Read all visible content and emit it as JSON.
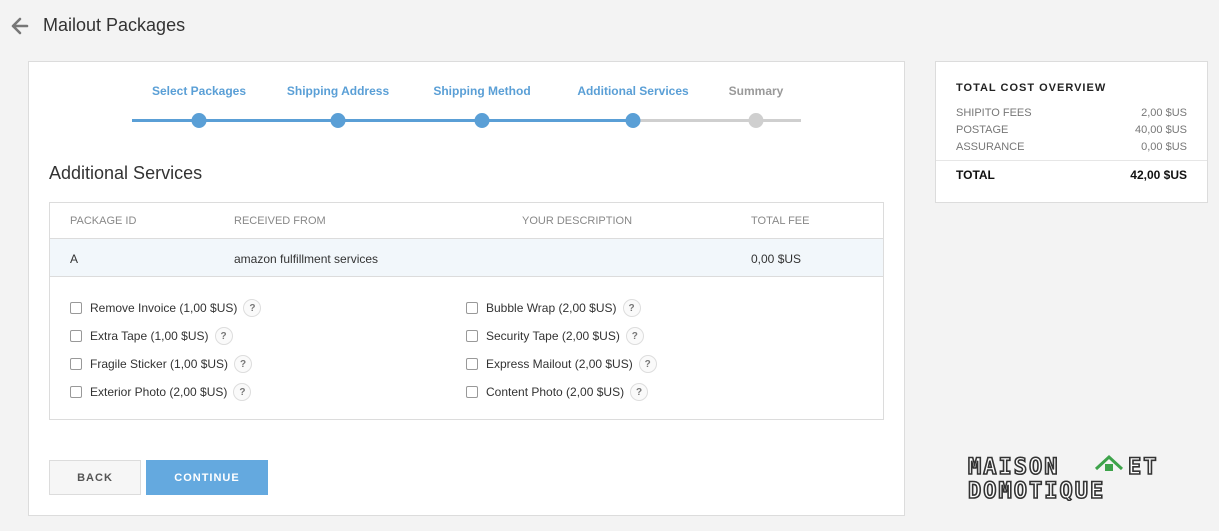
{
  "header": {
    "title": "Mailout Packages"
  },
  "stepper": {
    "steps": [
      {
        "label": "Select Packages",
        "state": "done"
      },
      {
        "label": "Shipping Address",
        "state": "done"
      },
      {
        "label": "Shipping Method",
        "state": "done"
      },
      {
        "label": "Additional Services",
        "state": "current"
      },
      {
        "label": "Summary",
        "state": "todo"
      }
    ]
  },
  "section": {
    "title": "Additional Services"
  },
  "table": {
    "columns": [
      "PACKAGE ID",
      "RECEIVED FROM",
      "YOUR DESCRIPTION",
      "TOTAL FEE"
    ],
    "rows": [
      {
        "package_id": "A",
        "received_from": "amazon fulfillment services",
        "description": "",
        "total_fee": "0,00 $US"
      }
    ]
  },
  "services": {
    "left": [
      {
        "label": "Remove Invoice (1,00 $US)",
        "checked": false
      },
      {
        "label": "Extra Tape (1,00 $US)",
        "checked": false
      },
      {
        "label": "Fragile Sticker (1,00 $US)",
        "checked": false
      },
      {
        "label": "Exterior Photo (2,00 $US)",
        "checked": false
      }
    ],
    "right": [
      {
        "label": "Bubble Wrap (2,00 $US)",
        "checked": false
      },
      {
        "label": "Security Tape (2,00 $US)",
        "checked": false
      },
      {
        "label": "Express Mailout (2,00 $US)",
        "checked": false
      },
      {
        "label": "Content Photo (2,00 $US)",
        "checked": false
      }
    ],
    "help_glyph": "?"
  },
  "buttons": {
    "back": "BACK",
    "continue": "CONTINUE"
  },
  "cost_overview": {
    "title": "TOTAL COST OVERVIEW",
    "rows": [
      {
        "name": "SHIPITO FEES",
        "value": "2,00 $US"
      },
      {
        "name": "POSTAGE",
        "value": "40,00 $US"
      },
      {
        "name": "ASSURANCE",
        "value": "0,00 $US"
      }
    ],
    "total": {
      "name": "TOTAL",
      "value": "42,00 $US"
    }
  },
  "watermark": {
    "line1": "MAISON",
    "line1b": "ET",
    "line2": "DOMOTIQUE"
  },
  "colors": {
    "accent": "#5a9fd6",
    "button_primary": "#64a9df",
    "inactive": "#cfcfcf"
  },
  "icons": {
    "back": "arrow-left-icon",
    "help": "question-circle-icon",
    "watermark_house": "house-icon"
  }
}
